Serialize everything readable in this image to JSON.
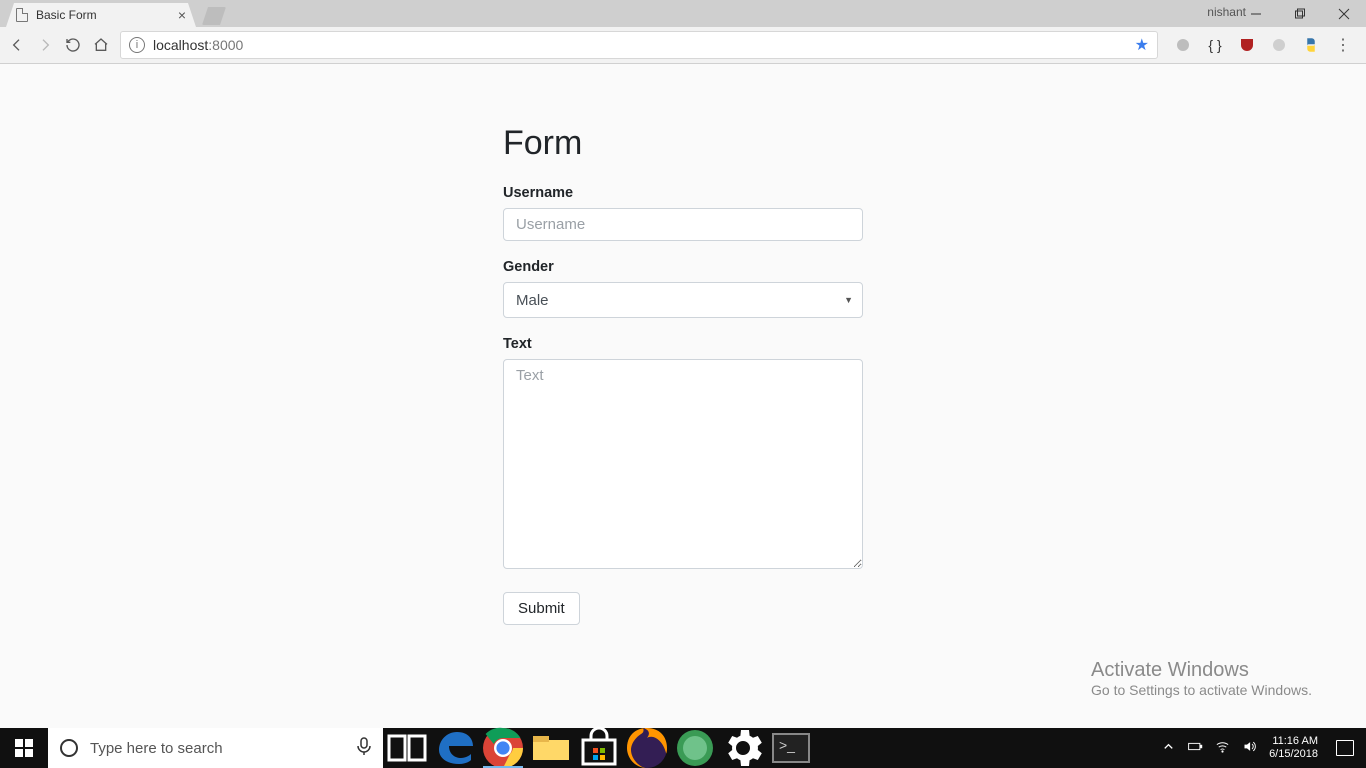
{
  "browser": {
    "tab_title": "Basic Form",
    "profile_name": "nishant",
    "url_host": "localhost",
    "url_rest": ":8000"
  },
  "page": {
    "heading": "Form",
    "username_label": "Username",
    "username_placeholder": "Username",
    "gender_label": "Gender",
    "gender_value": "Male",
    "text_label": "Text",
    "text_placeholder": "Text",
    "submit_label": "Submit"
  },
  "watermark": {
    "line1": "Activate Windows",
    "line2": "Go to Settings to activate Windows."
  },
  "taskbar": {
    "search_placeholder": "Type here to search",
    "time": "11:16 AM",
    "date": "6/15/2018"
  }
}
